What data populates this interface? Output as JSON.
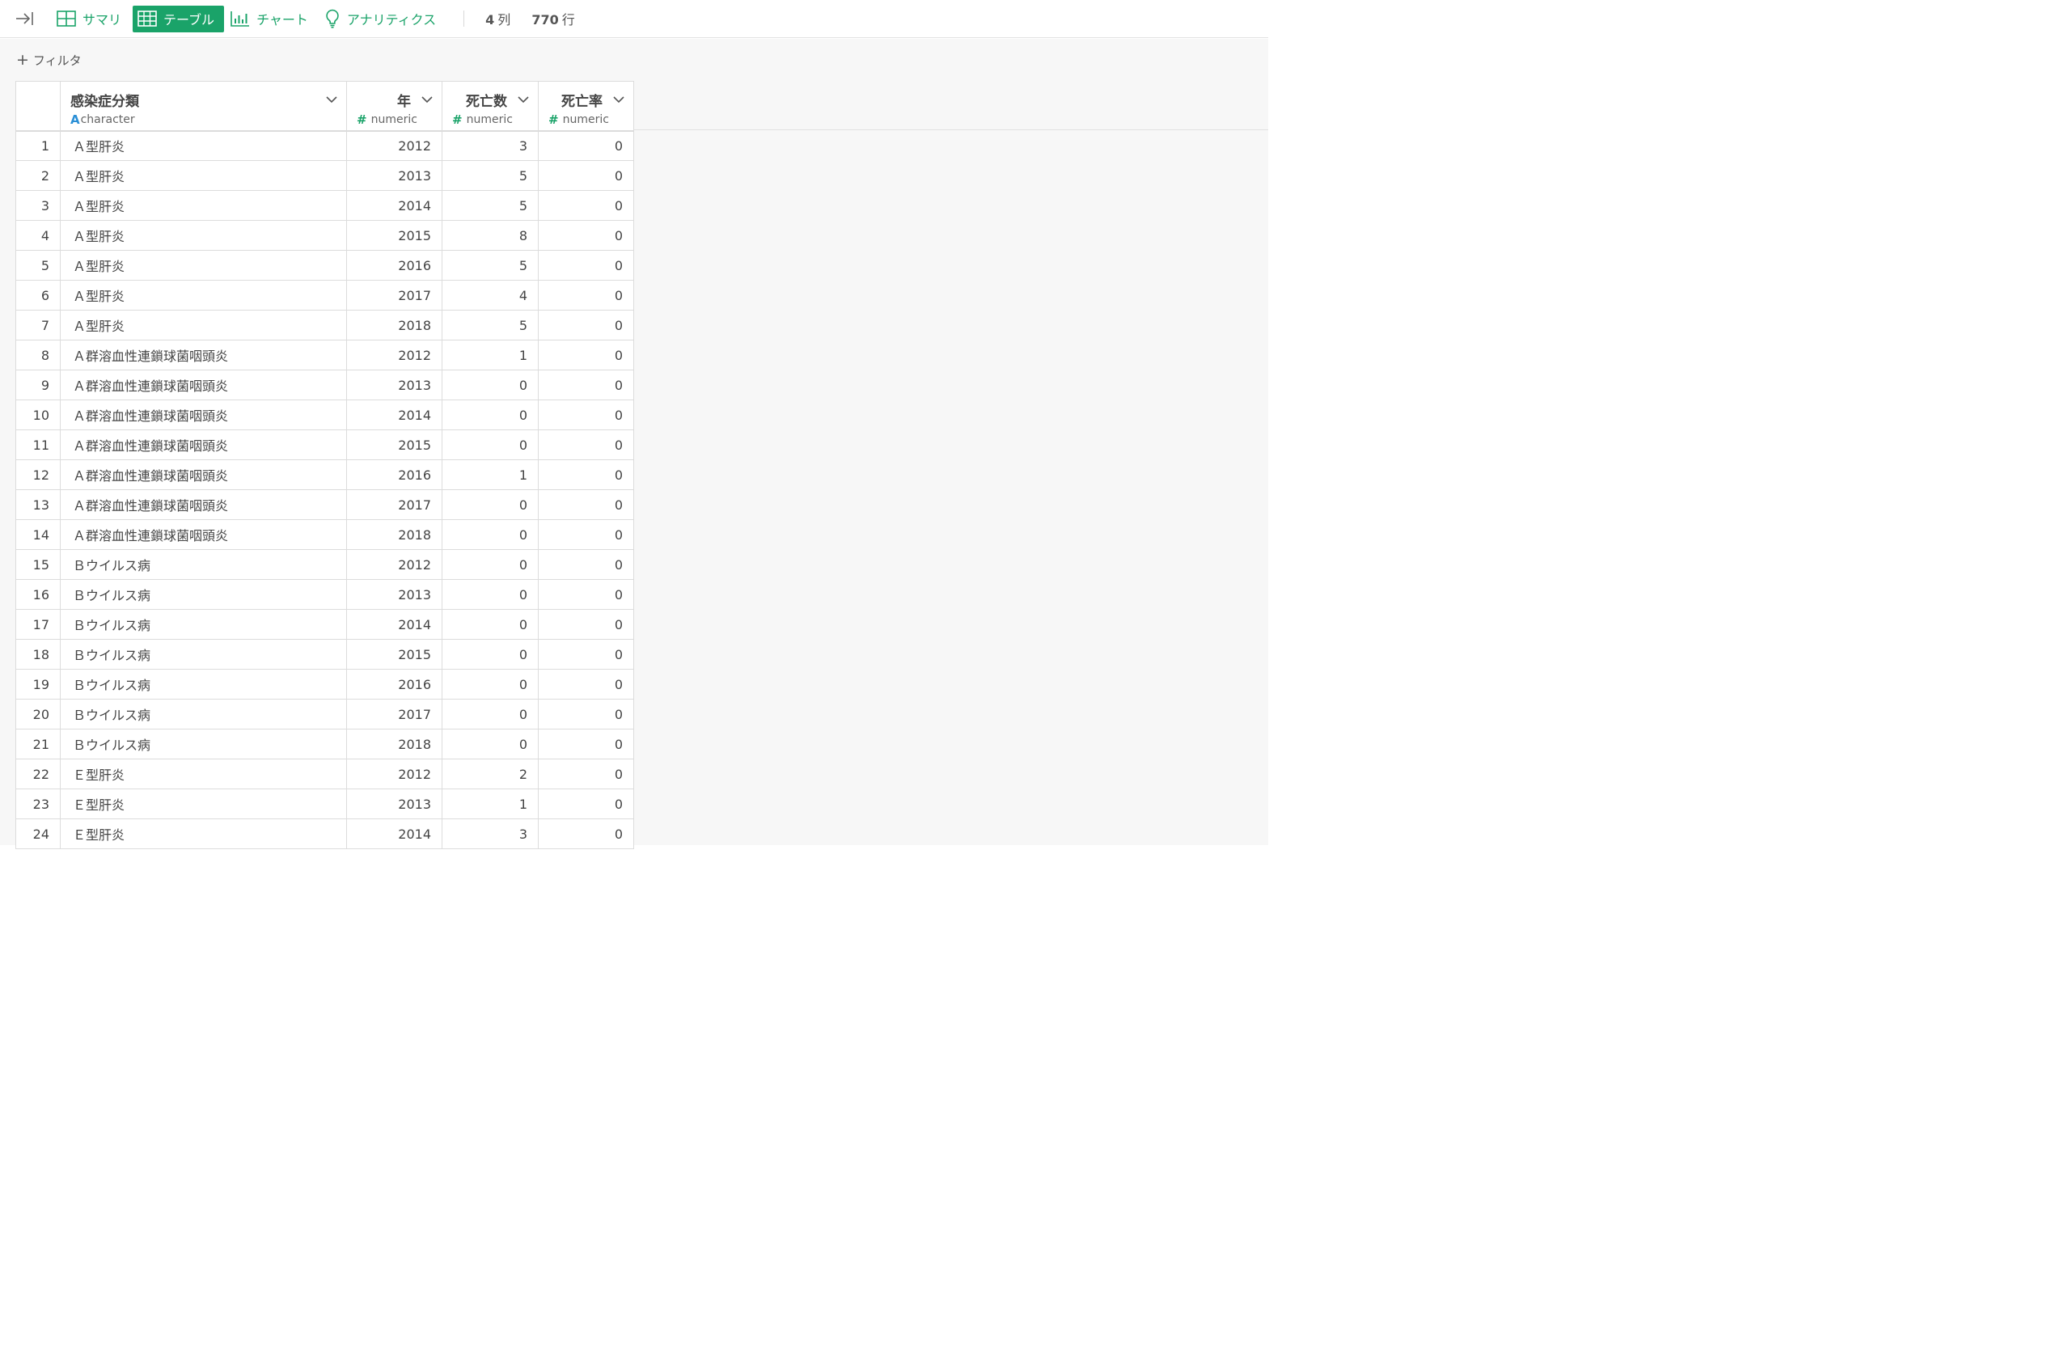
{
  "toolbar": {
    "tabs": [
      {
        "label": "サマリ",
        "icon": "summary-grid-icon",
        "active": false
      },
      {
        "label": "テーブル",
        "icon": "table-icon",
        "active": true
      },
      {
        "label": "チャート",
        "icon": "bar-chart-icon",
        "active": false
      },
      {
        "label": "アナリティクス",
        "icon": "lightbulb-icon",
        "active": false
      }
    ],
    "columns_count": "4",
    "columns_unit": "列",
    "rows_count": "770",
    "rows_unit": "行",
    "accent_color": "#1aa369"
  },
  "filter": {
    "label": "フィルタ"
  },
  "table": {
    "columns": [
      {
        "name": "感染症分類",
        "type": "character",
        "type_glyph": "A"
      },
      {
        "name": "年",
        "type": "numeric",
        "type_glyph": "#"
      },
      {
        "name": "死亡数",
        "type": "numeric",
        "type_glyph": "#"
      },
      {
        "name": "死亡率",
        "type": "numeric",
        "type_glyph": "#"
      }
    ],
    "rows": [
      [
        "1",
        "Ａ型肝炎",
        "2012",
        "3",
        "0"
      ],
      [
        "2",
        "Ａ型肝炎",
        "2013",
        "5",
        "0"
      ],
      [
        "3",
        "Ａ型肝炎",
        "2014",
        "5",
        "0"
      ],
      [
        "4",
        "Ａ型肝炎",
        "2015",
        "8",
        "0"
      ],
      [
        "5",
        "Ａ型肝炎",
        "2016",
        "5",
        "0"
      ],
      [
        "6",
        "Ａ型肝炎",
        "2017",
        "4",
        "0"
      ],
      [
        "7",
        "Ａ型肝炎",
        "2018",
        "5",
        "0"
      ],
      [
        "8",
        "Ａ群溶血性連鎖球菌咽頭炎",
        "2012",
        "1",
        "0"
      ],
      [
        "9",
        "Ａ群溶血性連鎖球菌咽頭炎",
        "2013",
        "0",
        "0"
      ],
      [
        "10",
        "Ａ群溶血性連鎖球菌咽頭炎",
        "2014",
        "0",
        "0"
      ],
      [
        "11",
        "Ａ群溶血性連鎖球菌咽頭炎",
        "2015",
        "0",
        "0"
      ],
      [
        "12",
        "Ａ群溶血性連鎖球菌咽頭炎",
        "2016",
        "1",
        "0"
      ],
      [
        "13",
        "Ａ群溶血性連鎖球菌咽頭炎",
        "2017",
        "0",
        "0"
      ],
      [
        "14",
        "Ａ群溶血性連鎖球菌咽頭炎",
        "2018",
        "0",
        "0"
      ],
      [
        "15",
        "Ｂウイルス病",
        "2012",
        "0",
        "0"
      ],
      [
        "16",
        "Ｂウイルス病",
        "2013",
        "0",
        "0"
      ],
      [
        "17",
        "Ｂウイルス病",
        "2014",
        "0",
        "0"
      ],
      [
        "18",
        "Ｂウイルス病",
        "2015",
        "0",
        "0"
      ],
      [
        "19",
        "Ｂウイルス病",
        "2016",
        "0",
        "0"
      ],
      [
        "20",
        "Ｂウイルス病",
        "2017",
        "0",
        "0"
      ],
      [
        "21",
        "Ｂウイルス病",
        "2018",
        "0",
        "0"
      ],
      [
        "22",
        "Ｅ型肝炎",
        "2012",
        "2",
        "0"
      ],
      [
        "23",
        "Ｅ型肝炎",
        "2013",
        "1",
        "0"
      ],
      [
        "24",
        "Ｅ型肝炎",
        "2014",
        "3",
        "0"
      ]
    ]
  }
}
